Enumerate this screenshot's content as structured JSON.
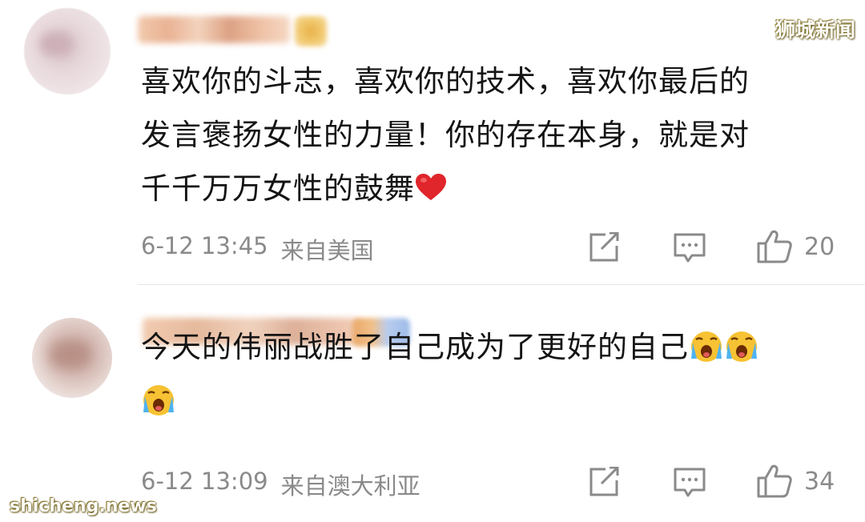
{
  "comments": [
    {
      "text_lines": [
        "喜欢你的斗志，喜欢你的技术，喜欢你最后的",
        "发言褒扬女性的力量！你的存在本身，就是对",
        "千千万万女性的鼓舞"
      ],
      "emoji": "heart-emoji",
      "time": "6-12 13:45",
      "location": "来自美国",
      "likes": "20"
    },
    {
      "text_lines": [
        "今天的伟丽战胜了自己成为了更好的自己"
      ],
      "emoji": "crying-face-emoji",
      "time": "6-12 13:09",
      "location": "来自澳大利亚",
      "likes": "34"
    }
  ],
  "watermarks": {
    "top_right": "狮城新闻",
    "bottom_left": "shicheng.news"
  },
  "colors": {
    "text": "#141414",
    "meta": "#8a8a8a",
    "heart": "#e0252b"
  }
}
